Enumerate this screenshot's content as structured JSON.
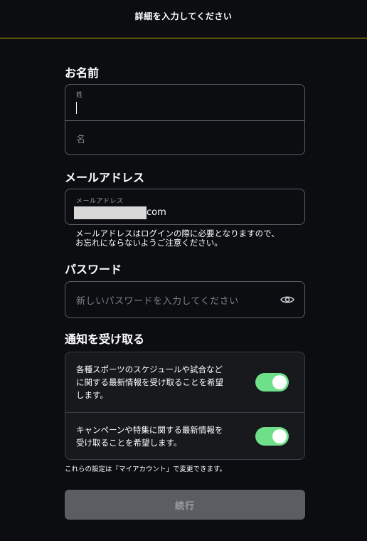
{
  "header": {
    "title": "詳細を入力してください"
  },
  "name_section": {
    "title": "お名前",
    "last_name_label": "姓",
    "first_name_placeholder": "名"
  },
  "email_section": {
    "title": "メールアドレス",
    "field_label": "メールアドレス",
    "value_suffix": "com",
    "help_line1": "メールアドレスはログインの際に必要となりますので、",
    "help_line2": "お忘れにならないようご注意ください。"
  },
  "password_section": {
    "title": "パスワード",
    "placeholder": "新しいパスワードを入力してください",
    "icon": "eye-icon"
  },
  "notifications": {
    "title": "通知を受け取る",
    "items": [
      {
        "line1": "各種スポーツのスケジュールや試合など",
        "line2": "に関する最新情報を受け取ることを希望",
        "line3": "します。",
        "enabled": true
      },
      {
        "line1": "キャンペーンや特集に関する最新情報を",
        "line2": "受け取ることを希望します。",
        "enabled": true
      }
    ],
    "note": "これらの設定は「マイアカウント」で変更できます。"
  },
  "actions": {
    "continue_label": "続行"
  },
  "colors": {
    "background": "#0b0d10",
    "accent_line": "#c9b400",
    "toggle_on": "#6fe08a",
    "button_disabled": "#5a5d62"
  }
}
